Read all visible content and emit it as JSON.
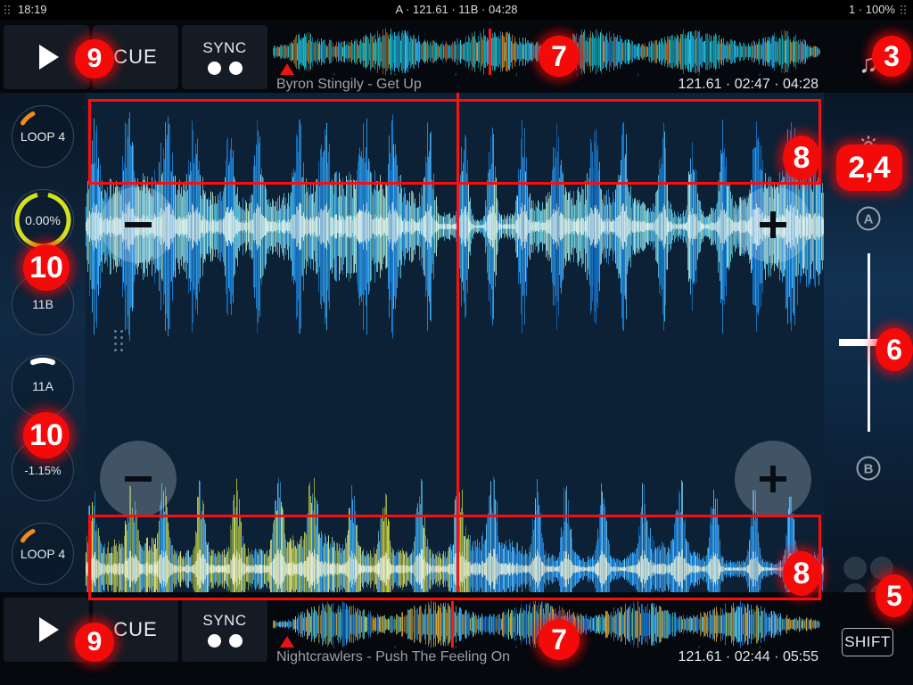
{
  "status_bar": {
    "time": "18:19",
    "center": "A · 121.61 · 11B · 04:28",
    "right": "1 · 100%"
  },
  "deck_a": {
    "play_label": "play-icon",
    "cue_label": "CUE",
    "sync_label": "SYNC",
    "track_title": "Byron Stingily - Get Up",
    "track_meta": "121.61 · 02:47 · 04:28",
    "bpm": "121.61",
    "elapsed": "02:47",
    "total": "04:28",
    "loop_label": "LOOP 4",
    "pitch_label": "0.00%",
    "key_label": "11B"
  },
  "deck_b": {
    "play_label": "play-icon",
    "cue_label": "CUE",
    "sync_label": "SYNC",
    "track_title": "Nightcrawlers - Push The Feeling On",
    "track_meta": "121.61 · 02:44 · 05:55",
    "bpm": "121.61",
    "elapsed": "02:44",
    "total": "05:55",
    "loop_label": "LOOP 4",
    "pitch_label": "-1.15%",
    "key_label": "11A"
  },
  "right_rail": {
    "note_icon": "♫",
    "gear_icon": "gear-icon",
    "deck_a_select": "A",
    "deck_b_select": "B",
    "shift_label": "SHIFT"
  },
  "annotations": [
    {
      "id": "3",
      "note": "music-library-icon"
    },
    {
      "id": "2,4",
      "note": "settings-gear-icon"
    },
    {
      "id": "6",
      "note": "crossfader"
    },
    {
      "id": "5",
      "note": "fx-pads-icon"
    },
    {
      "id": "9",
      "note": "cue-button-top"
    },
    {
      "id": "9",
      "note": "cue-button-bottom"
    },
    {
      "id": "7",
      "note": "overview-waveform-top"
    },
    {
      "id": "7",
      "note": "overview-waveform-bottom"
    },
    {
      "id": "8",
      "note": "deck-a-empty-lane"
    },
    {
      "id": "8",
      "note": "deck-b-empty-lane"
    },
    {
      "id": "10",
      "note": "pitch-knob-top"
    },
    {
      "id": "10",
      "note": "pitch-knob-bottom"
    }
  ],
  "colors": {
    "annotation_red": "#fc0d0d",
    "playhead_red": "#fb1111",
    "loop_arc": "#ef8c1b",
    "pitch_arc": "#d6e01c",
    "key_arc": "#ffffff",
    "waveform_blue": "#2a9df4",
    "waveform_cyan": "#26d7e0",
    "waveform_yellow": "#d3d94a",
    "panel_bg": "#0c2135"
  },
  "waveform_overview_a": {
    "playhead_pct": 39.5,
    "marker_pct": 1.5
  },
  "waveform_overview_b": {
    "playhead_pct": 32.5,
    "marker_pct": 1.5
  },
  "main_view": {
    "playhead_x_pct": 50.2,
    "zoom_out_label": "−",
    "zoom_in_label": "+"
  }
}
